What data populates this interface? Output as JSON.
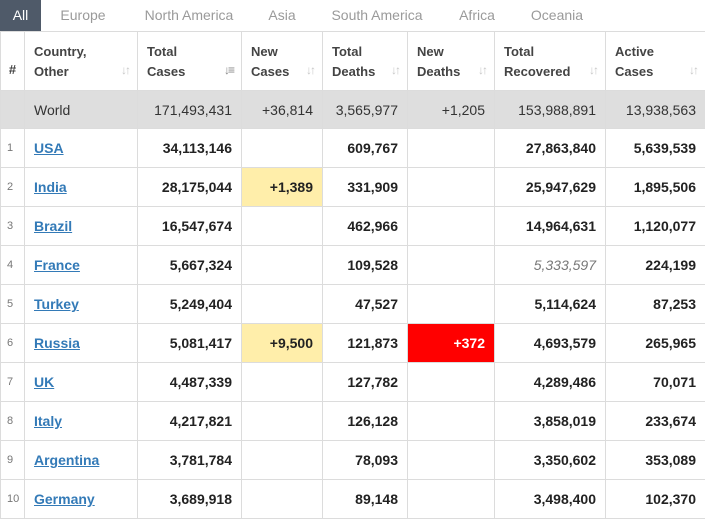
{
  "tabs": [
    "All",
    "Europe",
    "North America",
    "Asia",
    "South America",
    "Africa",
    "Oceania"
  ],
  "active_tab": "All",
  "columns": [
    {
      "line1": "#",
      "line2": ""
    },
    {
      "line1": "Country,",
      "line2": "Other"
    },
    {
      "line1": "Total",
      "line2": "Cases"
    },
    {
      "line1": "New",
      "line2": "Cases"
    },
    {
      "line1": "Total",
      "line2": "Deaths"
    },
    {
      "line1": "New",
      "line2": "Deaths"
    },
    {
      "line1": "Total",
      "line2": "Recovered"
    },
    {
      "line1": "Active",
      "line2": "Cases"
    }
  ],
  "world": {
    "label": "World",
    "total_cases": "171,493,431",
    "new_cases": "+36,814",
    "total_deaths": "3,565,977",
    "new_deaths": "+1,205",
    "total_recovered": "153,988,891",
    "active_cases": "13,938,563"
  },
  "rows": [
    {
      "idx": "1",
      "country": "USA",
      "total_cases": "34,113,146",
      "new_cases": "",
      "total_deaths": "609,767",
      "new_deaths": "",
      "total_recovered": "27,863,840",
      "active_cases": "5,639,539"
    },
    {
      "idx": "2",
      "country": "India",
      "total_cases": "28,175,044",
      "new_cases": "+1,389",
      "total_deaths": "331,909",
      "new_deaths": "",
      "total_recovered": "25,947,629",
      "active_cases": "1,895,506"
    },
    {
      "idx": "3",
      "country": "Brazil",
      "total_cases": "16,547,674",
      "new_cases": "",
      "total_deaths": "462,966",
      "new_deaths": "",
      "total_recovered": "14,964,631",
      "active_cases": "1,120,077"
    },
    {
      "idx": "4",
      "country": "France",
      "total_cases": "5,667,324",
      "new_cases": "",
      "total_deaths": "109,528",
      "new_deaths": "",
      "total_recovered": "5,333,597",
      "active_cases": "224,199"
    },
    {
      "idx": "5",
      "country": "Turkey",
      "total_cases": "5,249,404",
      "new_cases": "",
      "total_deaths": "47,527",
      "new_deaths": "",
      "total_recovered": "5,114,624",
      "active_cases": "87,253"
    },
    {
      "idx": "6",
      "country": "Russia",
      "total_cases": "5,081,417",
      "new_cases": "+9,500",
      "total_deaths": "121,873",
      "new_deaths": "+372",
      "total_recovered": "4,693,579",
      "active_cases": "265,965"
    },
    {
      "idx": "7",
      "country": "UK",
      "total_cases": "4,487,339",
      "new_cases": "",
      "total_deaths": "127,782",
      "new_deaths": "",
      "total_recovered": "4,289,486",
      "active_cases": "70,071"
    },
    {
      "idx": "8",
      "country": "Italy",
      "total_cases": "4,217,821",
      "new_cases": "",
      "total_deaths": "126,128",
      "new_deaths": "",
      "total_recovered": "3,858,019",
      "active_cases": "233,674"
    },
    {
      "idx": "9",
      "country": "Argentina",
      "total_cases": "3,781,784",
      "new_cases": "",
      "total_deaths": "78,093",
      "new_deaths": "",
      "total_recovered": "3,350,602",
      "active_cases": "353,089"
    },
    {
      "idx": "10",
      "country": "Germany",
      "total_cases": "3,689,918",
      "new_cases": "",
      "total_deaths": "89,148",
      "new_deaths": "",
      "total_recovered": "3,498,400",
      "active_cases": "102,370"
    }
  ],
  "colors": {
    "tab_active_bg": "#4f5a69",
    "link": "#337ab7",
    "new_cases_highlight": "#ffeeaa",
    "new_deaths_highlight": "#ff0000",
    "world_row_bg": "#dedede"
  },
  "icons": {
    "sort_icon": "sort-arrows-icon"
  }
}
